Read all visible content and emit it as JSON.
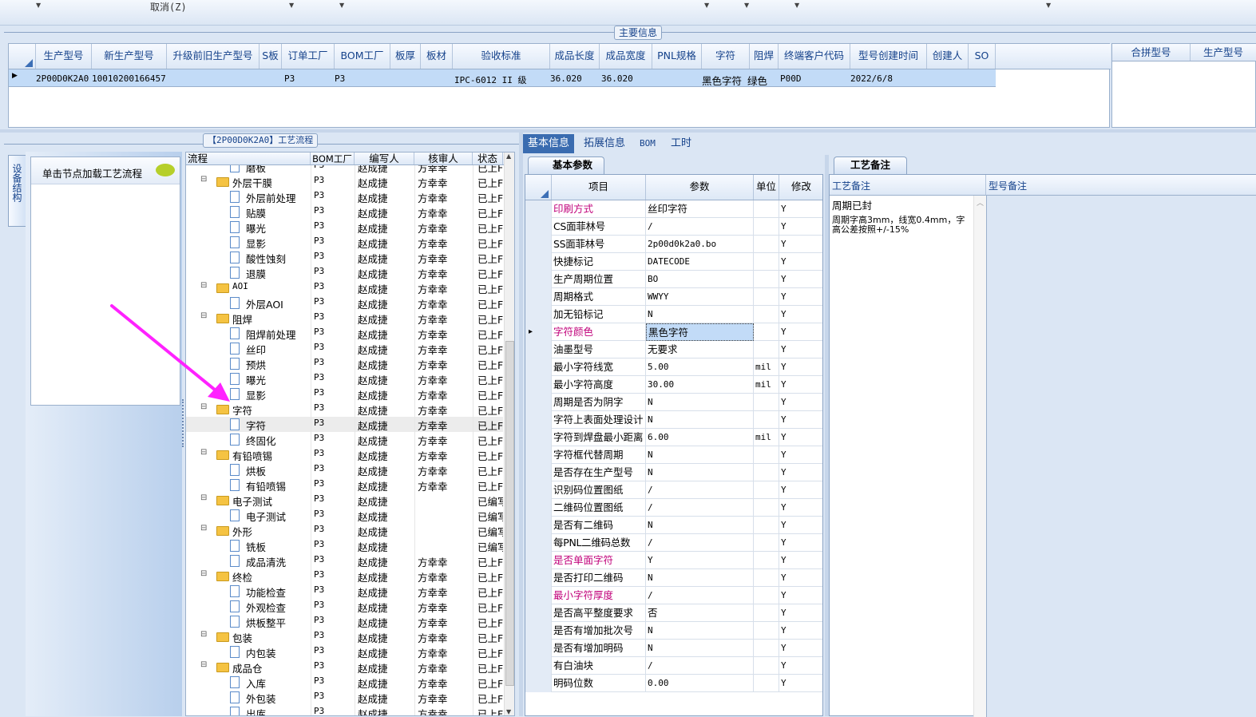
{
  "toolbar": {
    "cancel_label": "取消(Z)"
  },
  "main_info": {
    "title": "主要信息",
    "columns": [
      "生产型号",
      "新生产型号",
      "升级前旧生产型号",
      "S板",
      "订单工厂",
      "BOM工厂",
      "板厚",
      "板材",
      "验收标准",
      "成品长度",
      "成品宽度",
      "PNL规格",
      "字符",
      "阻焊",
      "终端客户代码",
      "型号创建时间",
      "创建人",
      "SO"
    ],
    "row": {
      "prod_model": "2P00D0K2A0",
      "new_model": "10010200166457",
      "order_factory": "P3",
      "bom_factory": "P3",
      "standard": "IPC-6012 II 级",
      "length": "36.020",
      "width": "36.020",
      "char": "黑色字符",
      "solder": "绿色",
      "customer": "P00D",
      "created": "2022/6/8"
    },
    "right_columns": [
      "合拼型号",
      "生产型号"
    ]
  },
  "flow_panel": {
    "title": "【2P00D0K2A0】工艺流程",
    "side_tab": "设备结构",
    "hint": "单击节点加载工艺流程"
  },
  "tree": {
    "columns": [
      "流程",
      "BOM工厂",
      "编写人",
      "核审人",
      "状态"
    ],
    "rows": [
      {
        "level": 2,
        "kind": "doc",
        "name": "磨板",
        "factory": "P3",
        "writer": "赵成捷",
        "reviewer": "方幸幸",
        "status": "已上F"
      },
      {
        "level": 1,
        "kind": "folder",
        "name": "外层干膜",
        "factory": "P3",
        "writer": "赵成捷",
        "reviewer": "方幸幸",
        "status": "已上F"
      },
      {
        "level": 2,
        "kind": "doc",
        "name": "外层前处理",
        "factory": "P3",
        "writer": "赵成捷",
        "reviewer": "方幸幸",
        "status": "已上F"
      },
      {
        "level": 2,
        "kind": "doc",
        "name": "贴膜",
        "factory": "P3",
        "writer": "赵成捷",
        "reviewer": "方幸幸",
        "status": "已上F"
      },
      {
        "level": 2,
        "kind": "doc",
        "name": "曝光",
        "factory": "P3",
        "writer": "赵成捷",
        "reviewer": "方幸幸",
        "status": "已上F"
      },
      {
        "level": 2,
        "kind": "doc",
        "name": "显影",
        "factory": "P3",
        "writer": "赵成捷",
        "reviewer": "方幸幸",
        "status": "已上F"
      },
      {
        "level": 2,
        "kind": "doc",
        "name": "酸性蚀刻",
        "factory": "P3",
        "writer": "赵成捷",
        "reviewer": "方幸幸",
        "status": "已上F"
      },
      {
        "level": 2,
        "kind": "doc",
        "name": "退膜",
        "factory": "P3",
        "writer": "赵成捷",
        "reviewer": "方幸幸",
        "status": "已上F"
      },
      {
        "level": 1,
        "kind": "folder",
        "name": "AOI",
        "factory": "P3",
        "writer": "赵成捷",
        "reviewer": "方幸幸",
        "status": "已上F"
      },
      {
        "level": 2,
        "kind": "doc",
        "name": "外层AOI",
        "factory": "P3",
        "writer": "赵成捷",
        "reviewer": "方幸幸",
        "status": "已上F"
      },
      {
        "level": 1,
        "kind": "folder",
        "name": "阻焊",
        "factory": "P3",
        "writer": "赵成捷",
        "reviewer": "方幸幸",
        "status": "已上F"
      },
      {
        "level": 2,
        "kind": "doc",
        "name": "阻焊前处理",
        "factory": "P3",
        "writer": "赵成捷",
        "reviewer": "方幸幸",
        "status": "已上F"
      },
      {
        "level": 2,
        "kind": "doc",
        "name": "丝印",
        "factory": "P3",
        "writer": "赵成捷",
        "reviewer": "方幸幸",
        "status": "已上F"
      },
      {
        "level": 2,
        "kind": "doc",
        "name": "预烘",
        "factory": "P3",
        "writer": "赵成捷",
        "reviewer": "方幸幸",
        "status": "已上F"
      },
      {
        "level": 2,
        "kind": "doc",
        "name": "曝光",
        "factory": "P3",
        "writer": "赵成捷",
        "reviewer": "方幸幸",
        "status": "已上F"
      },
      {
        "level": 2,
        "kind": "doc",
        "name": "显影",
        "factory": "P3",
        "writer": "赵成捷",
        "reviewer": "方幸幸",
        "status": "已上F"
      },
      {
        "level": 1,
        "kind": "folder",
        "name": "字符",
        "factory": "P3",
        "writer": "赵成捷",
        "reviewer": "方幸幸",
        "status": "已上F"
      },
      {
        "level": 2,
        "kind": "doc",
        "name": "字符",
        "factory": "P3",
        "writer": "赵成捷",
        "reviewer": "方幸幸",
        "status": "已上F",
        "selected": true
      },
      {
        "level": 2,
        "kind": "doc",
        "name": "终固化",
        "factory": "P3",
        "writer": "赵成捷",
        "reviewer": "方幸幸",
        "status": "已上F"
      },
      {
        "level": 1,
        "kind": "folder",
        "name": "有铅喷锡",
        "factory": "P3",
        "writer": "赵成捷",
        "reviewer": "方幸幸",
        "status": "已上F"
      },
      {
        "level": 2,
        "kind": "doc",
        "name": "烘板",
        "factory": "P3",
        "writer": "赵成捷",
        "reviewer": "方幸幸",
        "status": "已上F"
      },
      {
        "level": 2,
        "kind": "doc",
        "name": "有铅喷锡",
        "factory": "P3",
        "writer": "赵成捷",
        "reviewer": "方幸幸",
        "status": "已上F"
      },
      {
        "level": 1,
        "kind": "folder",
        "name": "电子测试",
        "factory": "P3",
        "writer": "赵成捷",
        "reviewer": "",
        "status": "已编写"
      },
      {
        "level": 2,
        "kind": "doc",
        "name": "电子测试",
        "factory": "P3",
        "writer": "赵成捷",
        "reviewer": "",
        "status": "已编写"
      },
      {
        "level": 1,
        "kind": "folder",
        "name": "外形",
        "factory": "P3",
        "writer": "赵成捷",
        "reviewer": "",
        "status": "已编写"
      },
      {
        "level": 2,
        "kind": "doc",
        "name": "铣板",
        "factory": "P3",
        "writer": "赵成捷",
        "reviewer": "",
        "status": "已编写"
      },
      {
        "level": 2,
        "kind": "doc",
        "name": "成品清洗",
        "factory": "P3",
        "writer": "赵成捷",
        "reviewer": "方幸幸",
        "status": "已上F"
      },
      {
        "level": 1,
        "kind": "folder",
        "name": "终检",
        "factory": "P3",
        "writer": "赵成捷",
        "reviewer": "方幸幸",
        "status": "已上F"
      },
      {
        "level": 2,
        "kind": "doc",
        "name": "功能检查",
        "factory": "P3",
        "writer": "赵成捷",
        "reviewer": "方幸幸",
        "status": "已上F"
      },
      {
        "level": 2,
        "kind": "doc",
        "name": "外观检查",
        "factory": "P3",
        "writer": "赵成捷",
        "reviewer": "方幸幸",
        "status": "已上F"
      },
      {
        "level": 2,
        "kind": "doc",
        "name": "烘板整平",
        "factory": "P3",
        "writer": "赵成捷",
        "reviewer": "方幸幸",
        "status": "已上F"
      },
      {
        "level": 1,
        "kind": "folder",
        "name": "包装",
        "factory": "P3",
        "writer": "赵成捷",
        "reviewer": "方幸幸",
        "status": "已上F"
      },
      {
        "level": 2,
        "kind": "doc",
        "name": "内包装",
        "factory": "P3",
        "writer": "赵成捷",
        "reviewer": "方幸幸",
        "status": "已上F"
      },
      {
        "level": 1,
        "kind": "folder",
        "name": "成品仓",
        "factory": "P3",
        "writer": "赵成捷",
        "reviewer": "方幸幸",
        "status": "已上F"
      },
      {
        "level": 2,
        "kind": "doc",
        "name": "入库",
        "factory": "P3",
        "writer": "赵成捷",
        "reviewer": "方幸幸",
        "status": "已上F"
      },
      {
        "level": 2,
        "kind": "doc",
        "name": "外包装",
        "factory": "P3",
        "writer": "赵成捷",
        "reviewer": "方幸幸",
        "status": "已上F"
      },
      {
        "level": 2,
        "kind": "doc",
        "name": "出库",
        "factory": "P3",
        "writer": "赵成捷",
        "reviewer": "方幸幸",
        "status": "已上F"
      }
    ]
  },
  "tabs": [
    "基本信息",
    "拓展信息",
    "BOM",
    "工时"
  ],
  "basic": {
    "title": "基本参数",
    "columns": [
      "项目",
      "参数",
      "单位",
      "修改"
    ],
    "rows": [
      {
        "item": "印刷方式",
        "value": "丝印字符",
        "unit": "",
        "mod": "Y",
        "highlight": true
      },
      {
        "item": "CS面菲林号",
        "value": "/",
        "unit": "",
        "mod": "Y"
      },
      {
        "item": "SS面菲林号",
        "value": "2p00d0k2a0.bo",
        "unit": "",
        "mod": "Y"
      },
      {
        "item": "快捷标记",
        "value": "DATECODE",
        "unit": "",
        "mod": "Y"
      },
      {
        "item": "生产周期位置",
        "value": "BO",
        "unit": "",
        "mod": "Y"
      },
      {
        "item": "周期格式",
        "value": "WWYY",
        "unit": "",
        "mod": "Y"
      },
      {
        "item": "加无铅标记",
        "value": "N",
        "unit": "",
        "mod": "Y"
      },
      {
        "item": "字符颜色",
        "value": "黑色字符",
        "unit": "",
        "mod": "Y",
        "highlight": true,
        "current": true
      },
      {
        "item": "油墨型号",
        "value": "无要求",
        "unit": "",
        "mod": "Y"
      },
      {
        "item": "最小字符线宽",
        "value": "5.00",
        "unit": "mil",
        "mod": "Y"
      },
      {
        "item": "最小字符高度",
        "value": "30.00",
        "unit": "mil",
        "mod": "Y"
      },
      {
        "item": "周期是否为阴字",
        "value": "N",
        "unit": "",
        "mod": "Y"
      },
      {
        "item": "字符上表面处理设计",
        "value": "N",
        "unit": "",
        "mod": "Y"
      },
      {
        "item": "字符到焊盘最小距离",
        "value": "6.00",
        "unit": "mil",
        "mod": "Y"
      },
      {
        "item": "字符框代替周期",
        "value": "N",
        "unit": "",
        "mod": "Y"
      },
      {
        "item": "是否存在生产型号",
        "value": "N",
        "unit": "",
        "mod": "Y"
      },
      {
        "item": "识别码位置图纸",
        "value": "/",
        "unit": "",
        "mod": "Y"
      },
      {
        "item": "二维码位置图纸",
        "value": "/",
        "unit": "",
        "mod": "Y"
      },
      {
        "item": "是否有二维码",
        "value": "N",
        "unit": "",
        "mod": "Y"
      },
      {
        "item": "每PNL二维码总数",
        "value": "/",
        "unit": "",
        "mod": "Y"
      },
      {
        "item": "是否单面字符",
        "value": "Y",
        "unit": "",
        "mod": "Y",
        "highlight": true
      },
      {
        "item": "是否打印二维码",
        "value": "N",
        "unit": "",
        "mod": "Y"
      },
      {
        "item": "最小字符厚度",
        "value": "/",
        "unit": "",
        "mod": "Y",
        "highlight": true
      },
      {
        "item": "是否高平整度要求",
        "value": "否",
        "unit": "",
        "mod": "Y"
      },
      {
        "item": "是否有增加批次号",
        "value": "N",
        "unit": "",
        "mod": "Y"
      },
      {
        "item": "是否有增加明码",
        "value": "N",
        "unit": "",
        "mod": "Y"
      },
      {
        "item": "有白油块",
        "value": "/",
        "unit": "",
        "mod": "Y"
      },
      {
        "item": "明码位数",
        "value": "0.00",
        "unit": "",
        "mod": "Y"
      }
    ]
  },
  "remarks": {
    "title": "工艺备注",
    "col1": "工艺备注",
    "col2": "型号备注",
    "line1": "周期已封",
    "line2": "周期字高3mm，线宽0.4mm，字高公差按照+/-15%"
  },
  "colors": {
    "accent": "#15428b",
    "highlight_text": "#c0007a",
    "arrow": "#ff22ff"
  }
}
